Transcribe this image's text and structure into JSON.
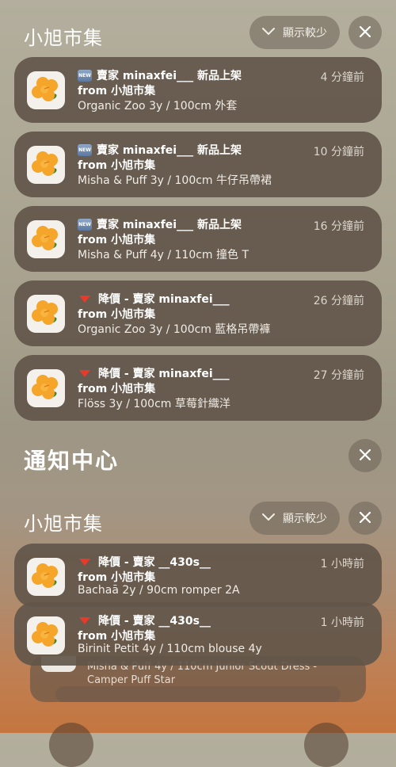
{
  "group1": {
    "title": "小旭市集",
    "collapse_label": "顯示較少"
  },
  "notifications_top": [
    {
      "badge": "new",
      "title": "賣家 minaxfei___ 新品上架",
      "subtitle": "from 小旭市集",
      "body": "Organic Zoo 3y / 100cm 外套",
      "time": "4 分鐘前"
    },
    {
      "badge": "new",
      "title": "賣家 minaxfei___ 新品上架",
      "subtitle": "from 小旭市集",
      "body": "Misha & Puff 3y / 100cm 牛仔吊帶裙",
      "time": "10 分鐘前"
    },
    {
      "badge": "new",
      "title": "賣家 minaxfei___ 新品上架",
      "subtitle": "from 小旭市集",
      "body": "Misha & Puff 4y / 110cm 撞色 T",
      "time": "16 分鐘前"
    },
    {
      "badge": "down",
      "title": "降價 - 賣家 minaxfei___",
      "subtitle": "from 小旭市集",
      "body": "Organic Zoo 3y / 100cm 藍格吊帶褲",
      "time": "26 分鐘前"
    },
    {
      "badge": "down",
      "title": "降價 - 賣家 minaxfei___",
      "subtitle": "from 小旭市集",
      "body": "Flöss 3y / 100cm 草莓針織洋",
      "time": "27 分鐘前"
    }
  ],
  "section": {
    "title": "通知中心"
  },
  "group2": {
    "title": "小旭市集",
    "collapse_label": "顯示較少"
  },
  "notifications_bottom": [
    {
      "badge": "down",
      "title": "降價 - 賣家 __430s__",
      "subtitle": "from 小旭市集",
      "body": "Bachaā 2y / 90cm romper 2A",
      "time": "1 小時前"
    },
    {
      "badge": "down",
      "title": "降價 - 賣家 __430s__",
      "subtitle": "from 小旭市集",
      "body": "Birinit Petit 4y / 110cm blouse 4y",
      "time": "1 小時前"
    }
  ],
  "stacked_preview": {
    "line1": "Misha & Puff 4y / 110cm Junior Scout Dress -",
    "line2": "Camper Puff Star"
  },
  "new_badge_text": "NEW",
  "colors": {
    "accent_down": "#e83a2a",
    "card_bg": "#62564a",
    "app_icon_flower": "#f4a52a"
  }
}
